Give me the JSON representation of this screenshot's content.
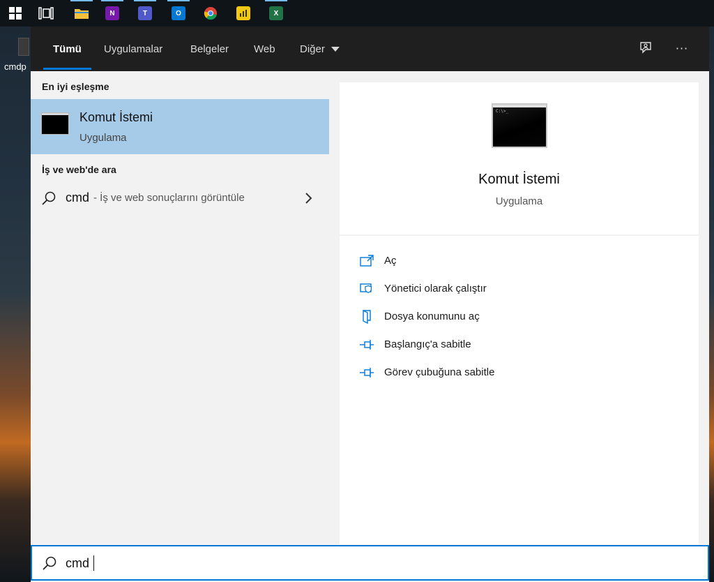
{
  "taskbar": {
    "apps": [
      {
        "name": "file-explorer-icon",
        "color": "#f3c13a"
      },
      {
        "name": "onenote-icon",
        "color": "#7719aa",
        "glyph": "N"
      },
      {
        "name": "teams-icon",
        "color": "#5059c9",
        "glyph": "T"
      },
      {
        "name": "outlook-icon",
        "color": "#0078d4",
        "glyph": "O"
      },
      {
        "name": "chrome-icon",
        "color": "#4285f4"
      },
      {
        "name": "power-bi-icon",
        "color": "#f2c811"
      },
      {
        "name": "excel-icon",
        "color": "#217346",
        "glyph": "X"
      }
    ]
  },
  "desktop": {
    "icon_label": "cmdp"
  },
  "header": {
    "tabs": [
      {
        "label": "Tümü",
        "active": true
      },
      {
        "label": "Uygulamalar"
      },
      {
        "label": "Belgeler"
      },
      {
        "label": "Web"
      },
      {
        "label": "Diğer"
      }
    ],
    "feedback_icon": "feedback-icon",
    "more_icon": "more-options-icon",
    "more_glyph": "···"
  },
  "results": {
    "best_match_heading": "En iyi eşleşme",
    "best_match": {
      "title": "Komut İstemi",
      "subtitle": "Uygulama"
    },
    "web_heading": "İş ve web'de ara",
    "web_result": {
      "query": "cmd",
      "hint": "- İş ve web sonuçlarını görüntüle"
    }
  },
  "detail": {
    "title": "Komut İstemi",
    "subtitle": "Uygulama",
    "thumb_prompt": "C:\\>_",
    "actions": [
      {
        "label": "Aç",
        "icon": "open-icon"
      },
      {
        "label": "Yönetici olarak çalıştır",
        "icon": "admin-shield-icon"
      },
      {
        "label": "Dosya konumunu aç",
        "icon": "file-location-icon"
      },
      {
        "label": "Başlangıç'a sabitle",
        "icon": "pin-icon"
      },
      {
        "label": "Görev çubuğuna sabitle",
        "icon": "pin-icon"
      }
    ]
  },
  "searchbox": {
    "value": "cmd"
  },
  "colors": {
    "accent": "#0078d7",
    "selection": "#a6cbe8"
  }
}
